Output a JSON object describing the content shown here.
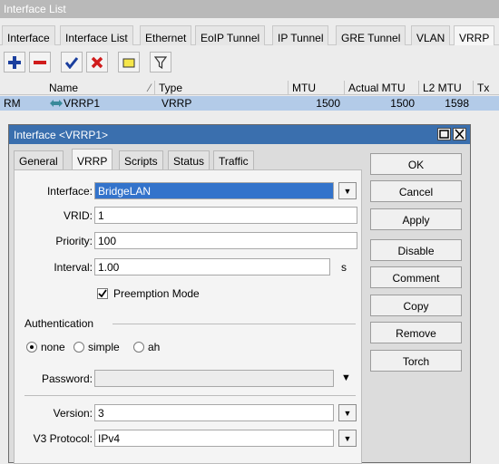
{
  "window": {
    "title": "Interface List"
  },
  "tabs": [
    "Interface",
    "Interface List",
    "Ethernet",
    "EoIP Tunnel",
    "IP Tunnel",
    "GRE Tunnel",
    "VLAN",
    "VRRP"
  ],
  "table": {
    "headers": {
      "name": "Name",
      "type": "Type",
      "mtu": "MTU",
      "actual_mtu": "Actual MTU",
      "l2_mtu": "L2 MTU",
      "tx": "Tx"
    },
    "row": {
      "flags": "RM",
      "name": "VRRP1",
      "type": "VRRP",
      "mtu": "1500",
      "actual_mtu": "1500",
      "l2_mtu": "1598"
    }
  },
  "dialog": {
    "title": "Interface <VRRP1>",
    "tabs": [
      "General",
      "VRRP",
      "Scripts",
      "Status",
      "Traffic"
    ],
    "fields": {
      "interface_label": "Interface:",
      "interface_value": "BridgeLAN",
      "vrid_label": "VRID:",
      "vrid_value": "1",
      "priority_label": "Priority:",
      "priority_value": "100",
      "interval_label": "Interval:",
      "interval_value": "1.00",
      "interval_unit": "s",
      "preemption_label": "Preemption Mode",
      "auth_section": "Authentication",
      "auth_none": "none",
      "auth_simple": "simple",
      "auth_ah": "ah",
      "password_label": "Password:",
      "version_label": "Version:",
      "version_value": "3",
      "v3_label": "V3 Protocol:",
      "v3_value": "IPv4"
    },
    "buttons": [
      "OK",
      "Cancel",
      "Apply",
      "Disable",
      "Comment",
      "Copy",
      "Remove",
      "Torch"
    ]
  },
  "colors": {
    "titlebar": "#b9b9b9",
    "dialog_title": "#3a6fae",
    "selection": "#3373cb",
    "row_selected": "#b3cbe8"
  }
}
